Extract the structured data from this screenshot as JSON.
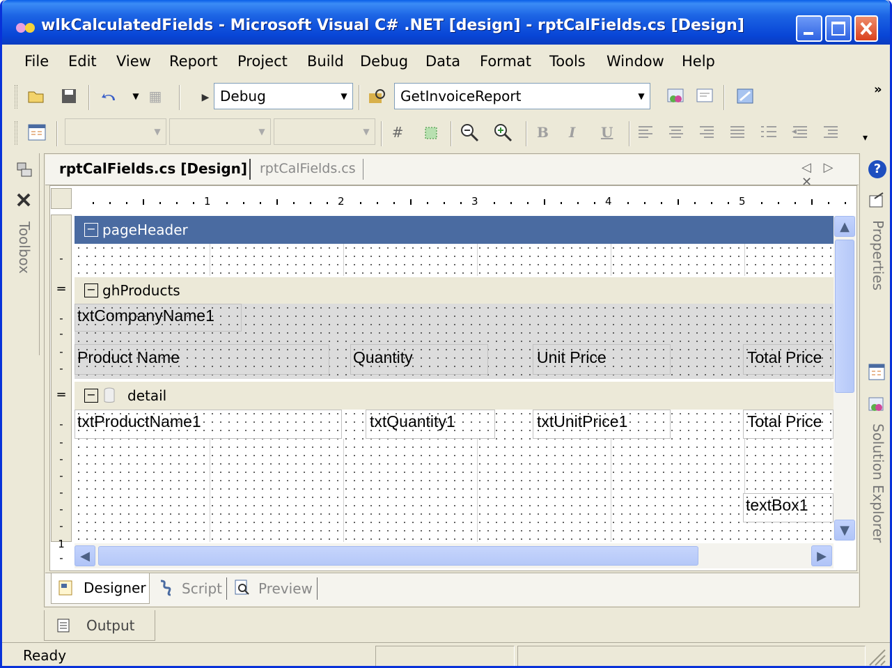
{
  "window": {
    "title": "wlkCalculatedFields - Microsoft Visual C# .NET [design] - rptCalFields.cs [Design]"
  },
  "menu": [
    "File",
    "Edit",
    "View",
    "Report",
    "Project",
    "Build",
    "Debug",
    "Data",
    "Format",
    "Tools",
    "Window",
    "Help"
  ],
  "toolbar1": {
    "config_value": "Debug",
    "find_value": "GetInvoiceReport",
    "overflow": "»"
  },
  "toolbar2": {
    "bold": "B",
    "italic": "I",
    "underline": "U"
  },
  "side": {
    "toolbox": "Toolbox",
    "properties": "Properties",
    "solution_explorer": "Solution Explorer"
  },
  "doctabs": {
    "active": "rptCalFields.cs [Design]",
    "inactive": "rptCalFields.cs",
    "nav": "◁ ▷ ✕"
  },
  "ruler": {
    "marks": [
      "1",
      "2",
      "3",
      "4",
      "5"
    ],
    "left_marks": [
      "1"
    ]
  },
  "report": {
    "bands": {
      "pageHeader": "pageHeader",
      "ghProducts": "ghProducts",
      "detail": "detail"
    },
    "group_fields": {
      "company": "txtCompanyName1",
      "product_name": "Product Name",
      "quantity": "Quantity",
      "unit_price": "Unit Price",
      "total_price": "Total Price"
    },
    "detail_fields": {
      "product_name": "txtProductName1",
      "quantity": "txtQuantity1",
      "unit_price": "txtUnitPrice1",
      "total_price": "Total Price",
      "textbox": "textBox1"
    }
  },
  "bottomtabs": {
    "designer": "Designer",
    "script": "Script",
    "preview": "Preview"
  },
  "output": "Output",
  "status": "Ready",
  "colors": {
    "titlebar": "#0A46D6",
    "band_selected": "#4A6BA1",
    "face": "#ECE9D8"
  }
}
